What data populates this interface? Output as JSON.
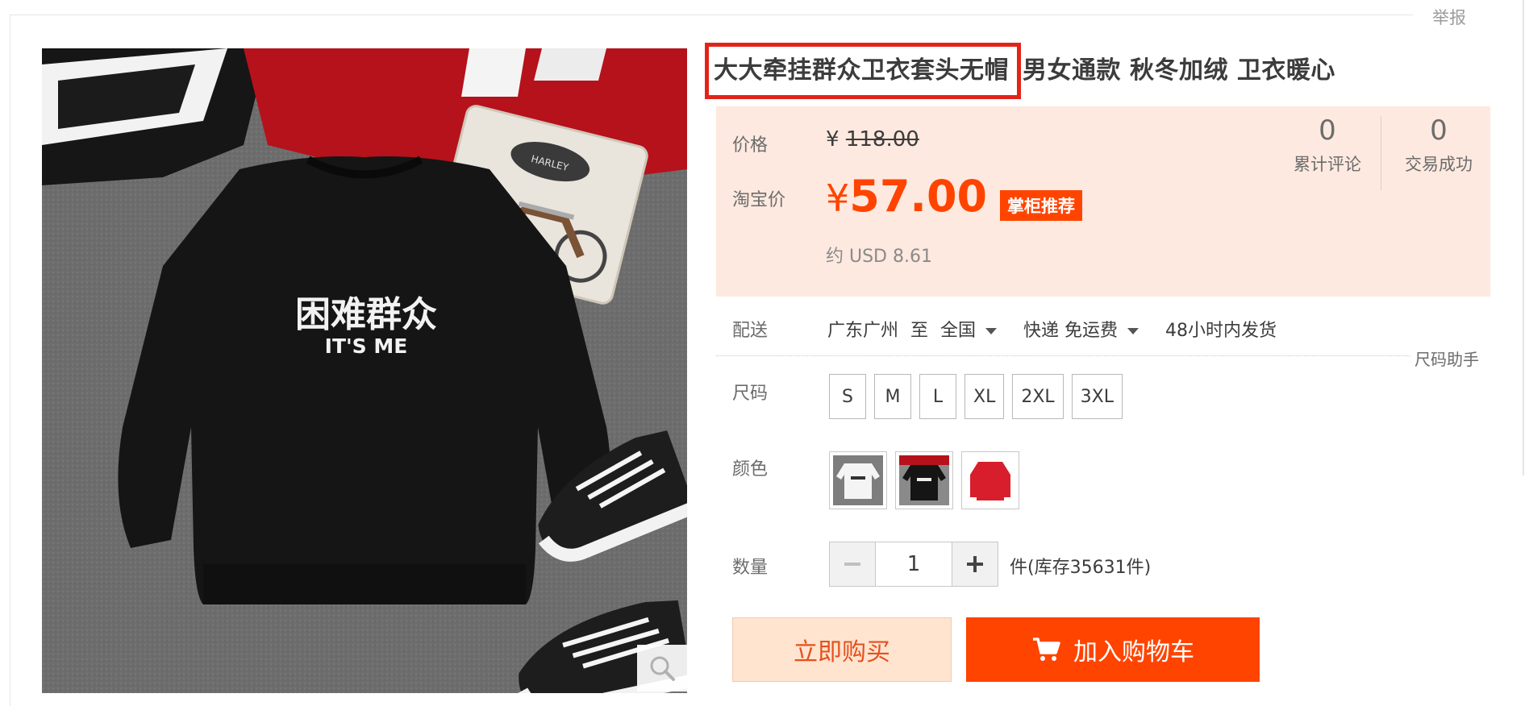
{
  "report_link": "举报",
  "product": {
    "title_highlighted": "大大牵挂群众卫衣套头无帽",
    "title_rest": "男女通款 秋冬加绒 卫衣暖心",
    "shirt_print_cn": "困难群众",
    "shirt_print_en": "IT'S ME"
  },
  "price": {
    "price_label": "价格",
    "original_currency": "¥",
    "original_price": "118.00",
    "taobao_label": "淘宝价",
    "currency": "¥",
    "taobao_price": "57.00",
    "badge": "掌柜推荐",
    "usd_approx": "约 USD 8.61",
    "accent_color": "#ff4400"
  },
  "stats": [
    {
      "count": "0",
      "label": "累计评论"
    },
    {
      "count": "0",
      "label": "交易成功"
    }
  ],
  "delivery": {
    "label": "配送",
    "from": "广东广州",
    "to_word": "至",
    "destination": "全国",
    "shipping": "快递 免运费",
    "dispatch": "48小时内发货"
  },
  "size_helper": "尺码助手",
  "size": {
    "label": "尺码",
    "options": [
      "S",
      "M",
      "L",
      "XL",
      "2XL",
      "3XL"
    ]
  },
  "color": {
    "label": "颜色",
    "options": [
      "white",
      "black",
      "red"
    ]
  },
  "quantity": {
    "label": "数量",
    "value": "1",
    "stock_text": "件(库存35631件)"
  },
  "actions": {
    "buy_now": "立即购买",
    "add_to_cart": "加入购物车"
  }
}
